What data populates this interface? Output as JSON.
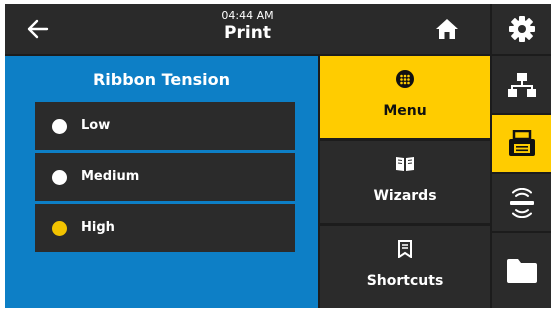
{
  "header": {
    "time": "04:44 AM",
    "title": "Print",
    "back_icon": "arrow-left-icon",
    "home_icon": "home-icon"
  },
  "panel": {
    "title": "Ribbon Tension",
    "options": [
      {
        "label": "Low",
        "selected": false
      },
      {
        "label": "Medium",
        "selected": false
      },
      {
        "label": "High",
        "selected": true
      }
    ],
    "background_color": "#0d7fc6",
    "selected_color": "#f2c300"
  },
  "menu_buttons": [
    {
      "label": "Menu",
      "icon": "dots-grid-icon",
      "selected": true
    },
    {
      "label": "Wizards",
      "icon": "open-book-icon",
      "selected": false
    },
    {
      "label": "Shortcuts",
      "icon": "bookmark-icon",
      "selected": false
    }
  ],
  "sidebar": {
    "items": [
      {
        "icon": "gear-icon",
        "selected": false
      },
      {
        "icon": "network-icon",
        "selected": false
      },
      {
        "icon": "printer-icon",
        "selected": true
      },
      {
        "icon": "wireless-connectivity-icon",
        "selected": false
      },
      {
        "icon": "folder-icon",
        "selected": false
      }
    ]
  },
  "accent_color": "#ffcc00"
}
